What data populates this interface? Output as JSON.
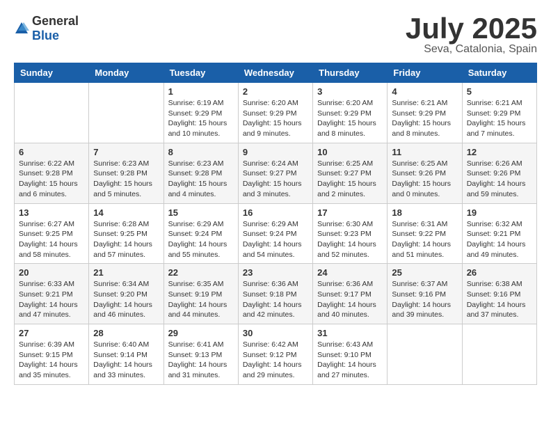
{
  "header": {
    "logo_general": "General",
    "logo_blue": "Blue",
    "month_title": "July 2025",
    "location": "Seva, Catalonia, Spain"
  },
  "weekdays": [
    "Sunday",
    "Monday",
    "Tuesday",
    "Wednesday",
    "Thursday",
    "Friday",
    "Saturday"
  ],
  "weeks": [
    [
      {
        "day": "",
        "info": ""
      },
      {
        "day": "",
        "info": ""
      },
      {
        "day": "1",
        "info": "Sunrise: 6:19 AM\nSunset: 9:29 PM\nDaylight: 15 hours and 10 minutes."
      },
      {
        "day": "2",
        "info": "Sunrise: 6:20 AM\nSunset: 9:29 PM\nDaylight: 15 hours and 9 minutes."
      },
      {
        "day": "3",
        "info": "Sunrise: 6:20 AM\nSunset: 9:29 PM\nDaylight: 15 hours and 8 minutes."
      },
      {
        "day": "4",
        "info": "Sunrise: 6:21 AM\nSunset: 9:29 PM\nDaylight: 15 hours and 8 minutes."
      },
      {
        "day": "5",
        "info": "Sunrise: 6:21 AM\nSunset: 9:29 PM\nDaylight: 15 hours and 7 minutes."
      }
    ],
    [
      {
        "day": "6",
        "info": "Sunrise: 6:22 AM\nSunset: 9:28 PM\nDaylight: 15 hours and 6 minutes."
      },
      {
        "day": "7",
        "info": "Sunrise: 6:23 AM\nSunset: 9:28 PM\nDaylight: 15 hours and 5 minutes."
      },
      {
        "day": "8",
        "info": "Sunrise: 6:23 AM\nSunset: 9:28 PM\nDaylight: 15 hours and 4 minutes."
      },
      {
        "day": "9",
        "info": "Sunrise: 6:24 AM\nSunset: 9:27 PM\nDaylight: 15 hours and 3 minutes."
      },
      {
        "day": "10",
        "info": "Sunrise: 6:25 AM\nSunset: 9:27 PM\nDaylight: 15 hours and 2 minutes."
      },
      {
        "day": "11",
        "info": "Sunrise: 6:25 AM\nSunset: 9:26 PM\nDaylight: 15 hours and 0 minutes."
      },
      {
        "day": "12",
        "info": "Sunrise: 6:26 AM\nSunset: 9:26 PM\nDaylight: 14 hours and 59 minutes."
      }
    ],
    [
      {
        "day": "13",
        "info": "Sunrise: 6:27 AM\nSunset: 9:25 PM\nDaylight: 14 hours and 58 minutes."
      },
      {
        "day": "14",
        "info": "Sunrise: 6:28 AM\nSunset: 9:25 PM\nDaylight: 14 hours and 57 minutes."
      },
      {
        "day": "15",
        "info": "Sunrise: 6:29 AM\nSunset: 9:24 PM\nDaylight: 14 hours and 55 minutes."
      },
      {
        "day": "16",
        "info": "Sunrise: 6:29 AM\nSunset: 9:24 PM\nDaylight: 14 hours and 54 minutes."
      },
      {
        "day": "17",
        "info": "Sunrise: 6:30 AM\nSunset: 9:23 PM\nDaylight: 14 hours and 52 minutes."
      },
      {
        "day": "18",
        "info": "Sunrise: 6:31 AM\nSunset: 9:22 PM\nDaylight: 14 hours and 51 minutes."
      },
      {
        "day": "19",
        "info": "Sunrise: 6:32 AM\nSunset: 9:21 PM\nDaylight: 14 hours and 49 minutes."
      }
    ],
    [
      {
        "day": "20",
        "info": "Sunrise: 6:33 AM\nSunset: 9:21 PM\nDaylight: 14 hours and 47 minutes."
      },
      {
        "day": "21",
        "info": "Sunrise: 6:34 AM\nSunset: 9:20 PM\nDaylight: 14 hours and 46 minutes."
      },
      {
        "day": "22",
        "info": "Sunrise: 6:35 AM\nSunset: 9:19 PM\nDaylight: 14 hours and 44 minutes."
      },
      {
        "day": "23",
        "info": "Sunrise: 6:36 AM\nSunset: 9:18 PM\nDaylight: 14 hours and 42 minutes."
      },
      {
        "day": "24",
        "info": "Sunrise: 6:36 AM\nSunset: 9:17 PM\nDaylight: 14 hours and 40 minutes."
      },
      {
        "day": "25",
        "info": "Sunrise: 6:37 AM\nSunset: 9:16 PM\nDaylight: 14 hours and 39 minutes."
      },
      {
        "day": "26",
        "info": "Sunrise: 6:38 AM\nSunset: 9:16 PM\nDaylight: 14 hours and 37 minutes."
      }
    ],
    [
      {
        "day": "27",
        "info": "Sunrise: 6:39 AM\nSunset: 9:15 PM\nDaylight: 14 hours and 35 minutes."
      },
      {
        "day": "28",
        "info": "Sunrise: 6:40 AM\nSunset: 9:14 PM\nDaylight: 14 hours and 33 minutes."
      },
      {
        "day": "29",
        "info": "Sunrise: 6:41 AM\nSunset: 9:13 PM\nDaylight: 14 hours and 31 minutes."
      },
      {
        "day": "30",
        "info": "Sunrise: 6:42 AM\nSunset: 9:12 PM\nDaylight: 14 hours and 29 minutes."
      },
      {
        "day": "31",
        "info": "Sunrise: 6:43 AM\nSunset: 9:10 PM\nDaylight: 14 hours and 27 minutes."
      },
      {
        "day": "",
        "info": ""
      },
      {
        "day": "",
        "info": ""
      }
    ]
  ]
}
